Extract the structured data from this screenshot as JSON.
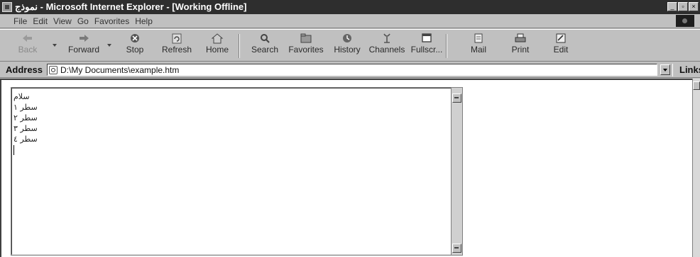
{
  "window": {
    "title": "نموذج - Microsoft Internet Explorer - [Working Offline]",
    "controls": [
      "minimize",
      "restore",
      "close"
    ]
  },
  "menu": [
    "File",
    "Edit",
    "View",
    "Go",
    "Favorites",
    "Help"
  ],
  "toolbar": {
    "buttons": [
      {
        "label": "Back",
        "icon": "back-arrow-icon",
        "enabled": false
      },
      {
        "label": "Forward",
        "icon": "forward-arrow-icon",
        "enabled": true
      },
      {
        "label": "Stop",
        "icon": "stop-icon",
        "enabled": true
      },
      {
        "label": "Refresh",
        "icon": "refresh-icon",
        "enabled": true
      },
      {
        "label": "Home",
        "icon": "home-icon",
        "enabled": true
      },
      {
        "label": "Search",
        "icon": "search-icon",
        "enabled": true
      },
      {
        "label": "Favorites",
        "icon": "favorites-icon",
        "enabled": true
      },
      {
        "label": "History",
        "icon": "history-icon",
        "enabled": true
      },
      {
        "label": "Channels",
        "icon": "channels-icon",
        "enabled": true
      },
      {
        "label": "Fullscr...",
        "icon": "fullscreen-icon",
        "enabled": true
      },
      {
        "label": "Mail",
        "icon": "mail-icon",
        "enabled": true
      },
      {
        "label": "Print",
        "icon": "print-icon",
        "enabled": true
      },
      {
        "label": "Edit",
        "icon": "edit-icon",
        "enabled": true
      }
    ]
  },
  "address": {
    "label": "Address",
    "value": "D:\\My Documents\\example.htm",
    "links_label": "Links"
  },
  "textarea": {
    "lines": [
      "سلام",
      "سطر ١",
      "سطر ٢",
      "سطر ٣",
      "سطر ٤"
    ]
  }
}
